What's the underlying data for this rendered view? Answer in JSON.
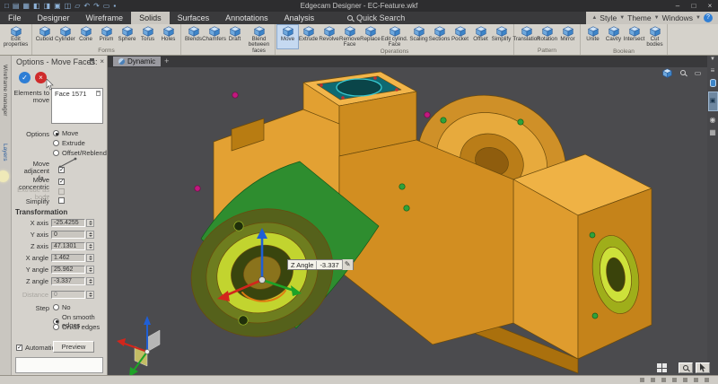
{
  "window": {
    "title": "Edgecam Designer - EC-Feature.wkf",
    "minimize": "–",
    "maximize": "□",
    "close": "×"
  },
  "menubar": {
    "tabs": [
      {
        "label": "File"
      },
      {
        "label": "Designer"
      },
      {
        "label": "Wireframe"
      },
      {
        "label": "Solids"
      },
      {
        "label": "Surfaces"
      },
      {
        "label": "Annotations"
      },
      {
        "label": "Analysis"
      }
    ],
    "active": "Solids",
    "search": "Quick Search"
  },
  "appbar": {
    "collapse": "▲",
    "style": "Style",
    "theme": "Theme",
    "windows": "Windows",
    "help": "?"
  },
  "ribbon": {
    "groups": [
      {
        "label": "",
        "items": [
          {
            "label": "Edit properties"
          }
        ]
      },
      {
        "label": "Forms",
        "items": [
          {
            "label": "Cuboid"
          },
          {
            "label": "Cylinder"
          },
          {
            "label": "Cone"
          },
          {
            "label": "Prism"
          },
          {
            "label": "Sphere"
          },
          {
            "label": "Torus"
          },
          {
            "label": "Holes"
          }
        ]
      },
      {
        "label": "",
        "items": [
          {
            "label": "Blends"
          },
          {
            "label": "Chamfers"
          },
          {
            "label": "Draft"
          },
          {
            "label": "Blend between faces"
          }
        ]
      },
      {
        "label": "Operations",
        "items": [
          {
            "label": "Move"
          },
          {
            "label": "Extrude"
          },
          {
            "label": "Revolve"
          },
          {
            "label": "Remove Face"
          },
          {
            "label": "Replace"
          },
          {
            "label": "Edit cylind. Face"
          },
          {
            "label": "Scaling"
          },
          {
            "label": "Sections"
          },
          {
            "label": "Pocket"
          },
          {
            "label": "Offset"
          },
          {
            "label": "Simplify"
          }
        ],
        "active": "Move"
      },
      {
        "label": "Pattern",
        "items": [
          {
            "label": "Translation"
          },
          {
            "label": "Rotation"
          },
          {
            "label": "Mirror"
          }
        ]
      },
      {
        "label": "Boolean",
        "items": [
          {
            "label": "Unite"
          },
          {
            "label": "Cavity"
          },
          {
            "label": "Intersect"
          },
          {
            "label": "Cut bodies"
          }
        ]
      }
    ]
  },
  "side_tabs": [
    {
      "label": "Wireframe manager"
    },
    {
      "label": "Layers"
    }
  ],
  "panel": {
    "title": "Options - Move Faces:",
    "elements_label": "Elements to move",
    "selection": {
      "items": [
        {
          "label": "Face 1571"
        }
      ]
    },
    "options_label": "Options",
    "radio_move": "Move",
    "radio_extrude": "Extrude",
    "radio_offset": "Offset/Reblend",
    "chk_adjacent": "Move adjacent fa...",
    "chk_concentric": "Move concentric ...",
    "chk_extrude_body": "Extrude as body",
    "chk_simplify": "Simplify",
    "transformation_label": "Transformation",
    "fields": [
      {
        "label": "X axis",
        "value": "-25.4255"
      },
      {
        "label": "Y axis",
        "value": "0"
      },
      {
        "label": "Z axis",
        "value": "47.1301"
      },
      {
        "label": "X angle",
        "value": "1.462"
      },
      {
        "label": "Y angle",
        "value": "25.962"
      },
      {
        "label": "Z angle",
        "value": "-3.337"
      }
    ],
    "distance": {
      "label": "Distance",
      "value": "0"
    },
    "step_label": "Step",
    "step_options": [
      {
        "label": "No"
      },
      {
        "label": "On smooth edges"
      },
      {
        "label": "On all edges"
      }
    ],
    "step_selected": "On smooth edges",
    "automatic_label": "Automatic",
    "preview_label": "Preview"
  },
  "viewport": {
    "tab": "Dynamic",
    "tooltip": {
      "label": "Z Angle",
      "value": "-3.337"
    }
  },
  "colors": {
    "accent_blue": "#2e7ed5",
    "part_orange": "#e3a133",
    "selected_face_green": "#2e8d2f",
    "highlight_yellow_green": "#c2d42f",
    "teal": "#0f6a72",
    "magenta": "#c2187e"
  }
}
